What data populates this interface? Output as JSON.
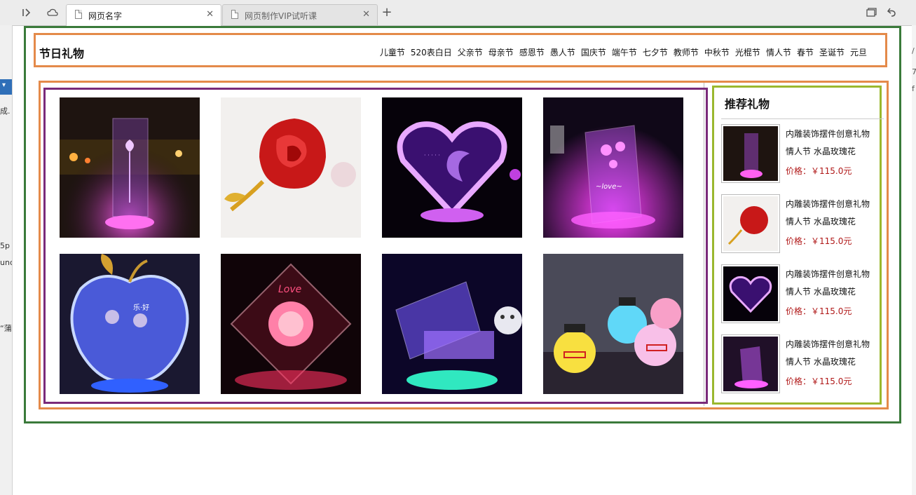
{
  "browser": {
    "tabs": [
      {
        "label": "网页名字",
        "active": true
      },
      {
        "label": "网页制作VIP试听课",
        "active": false
      }
    ],
    "new_tab": "+",
    "left_strip": [
      "成.",
      "5p",
      "und",
      "“蒲"
    ]
  },
  "header": {
    "brand": "节日礼物",
    "nav": [
      "儿童节",
      "520表白日",
      "父亲节",
      "母亲节",
      "感恩节",
      "愚人节",
      "国庆节",
      "端午节",
      "七夕节",
      "教师节",
      "中秋节",
      "光棍节",
      "情人节",
      "春节",
      "圣诞节",
      "元旦"
    ]
  },
  "gallery": {
    "images": [
      "crystal-rose-cube",
      "red-gold-rose",
      "crystal-heart",
      "crystal-flower-block",
      "crystal-apple",
      "crystal-love-rose-diamond",
      "crystal-piano",
      "octopus-lamps"
    ]
  },
  "sidebar": {
    "title": "推荐礼物",
    "items": [
      {
        "name_line1": "内雕装饰摆件创意礼物",
        "name_line2": "情人节 水晶玫瑰花",
        "price": "价格：￥115.0元",
        "image": "crystal-rose-cube"
      },
      {
        "name_line1": "内雕装饰摆件创意礼物",
        "name_line2": "情人节 水晶玫瑰花",
        "price": "价格：￥115.0元",
        "image": "red-gold-rose"
      },
      {
        "name_line1": "内雕装饰摆件创意礼物",
        "name_line2": "情人节 水晶玫瑰花",
        "price": "价格：￥115.0元",
        "image": "crystal-heart"
      },
      {
        "name_line1": "内雕装饰摆件创意礼物",
        "name_line2": "情人节 水晶玫瑰花",
        "price": "价格：￥115.0元",
        "image": "crystal-flower-block"
      }
    ]
  },
  "colors": {
    "outer_border": "#3a7a3a",
    "header_border": "#e48a4a",
    "gallery_border": "#7a2a7a",
    "sidebar_border": "#9ab82e",
    "price": "#b01818"
  }
}
